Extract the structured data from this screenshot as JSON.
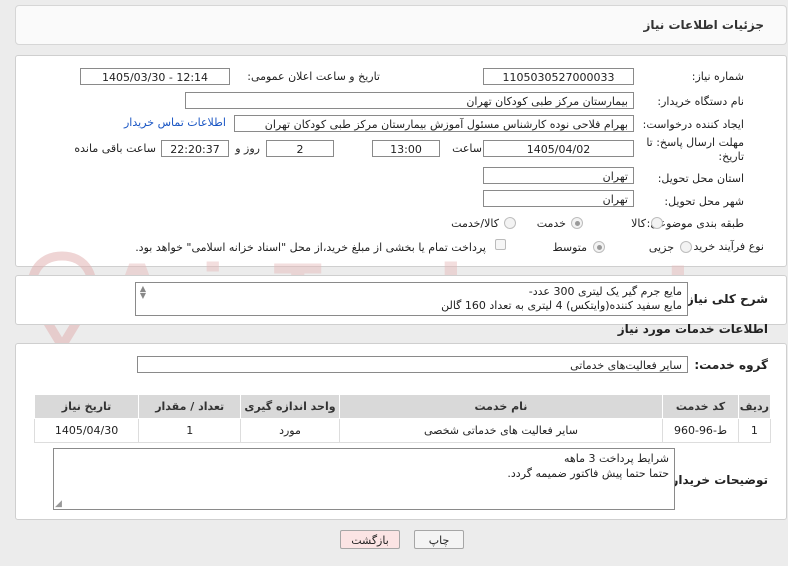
{
  "header": {
    "title": "جزئیات اطلاعات نیاز"
  },
  "form": {
    "need_number_label": "شماره نیاز:",
    "need_number": "1105030527000033",
    "announce_label": "تاریخ و ساعت اعلان عمومی:",
    "announce_value": "1405/03/30 - 12:14",
    "buyer_org_label": "نام دستگاه خریدار:",
    "buyer_org": "بیمارستان مرکز طبی کودکان تهران",
    "requester_label": "ایجاد کننده درخواست:",
    "requester": "بهرام فلاحی نوده کارشناس مسئول آموزش بیمارستان مرکز طبی کودکان تهران",
    "contact_link": "اطلاعات تماس خریدار",
    "deadline_label": "مهلت ارسال پاسخ: تا تاریخ:",
    "deadline_date": "1405/04/02",
    "time_label": "ساعت",
    "deadline_time": "13:00",
    "days_value": "2",
    "days_label": "روز و",
    "remaining_time": "22:20:37",
    "remaining_label": "ساعت باقی مانده",
    "province_label": "استان محل تحویل:",
    "province": "تهران",
    "city_label": "شهر محل تحویل:",
    "city": "تهران",
    "category_label": "طبقه بندی موضوعی:",
    "category_options": [
      "کالا",
      "خدمت",
      "کالا/خدمت"
    ],
    "category_selected": "خدمت",
    "process_label": "نوع فرآیند خرید :",
    "process_options": [
      "جزیی",
      "متوسط"
    ],
    "process_selected": "متوسط",
    "payment_note": "پرداخت تمام یا بخشی از مبلغ خرید،از محل \"اسناد خزانه اسلامی\" خواهد بود."
  },
  "summary": {
    "label": "شرح کلی نیاز:",
    "lines": [
      "مایع جرم گیر یک لیتری 300 عدد-",
      "مایع سفید کننده(وایتکس) 4 لیتری به تعداد 160 گالن"
    ]
  },
  "services": {
    "section_title": "اطلاعات خدمات مورد نیاز",
    "group_label": "گروه خدمت:",
    "group_value": "سایر فعالیت‌های خدماتی",
    "columns": [
      "ردیف",
      "کد خدمت",
      "نام خدمت",
      "واحد اندازه گیری",
      "تعداد / مقدار",
      "تاریخ نیاز"
    ],
    "rows": [
      [
        "1",
        "ط-96-960",
        "سایر فعالیت های خدماتی شخصی",
        "مورد",
        "1",
        "1405/04/30"
      ]
    ]
  },
  "buyer_notes": {
    "label": "توضیحات خریدار:",
    "lines": [
      "شرایط پرداخت 3 ماهه",
      "حتما حتما پیش فاکتور ضمیمه گردد."
    ]
  },
  "buttons": {
    "print": "چاپ",
    "back": "بازگشت"
  },
  "watermark": {
    "text": "AriaTender.net"
  },
  "colors": {
    "link": "#1a56c4",
    "back_button_bg": "#fbe4e4",
    "header_bg": "#d9d9d9",
    "watermark": "#e6b8b8"
  }
}
